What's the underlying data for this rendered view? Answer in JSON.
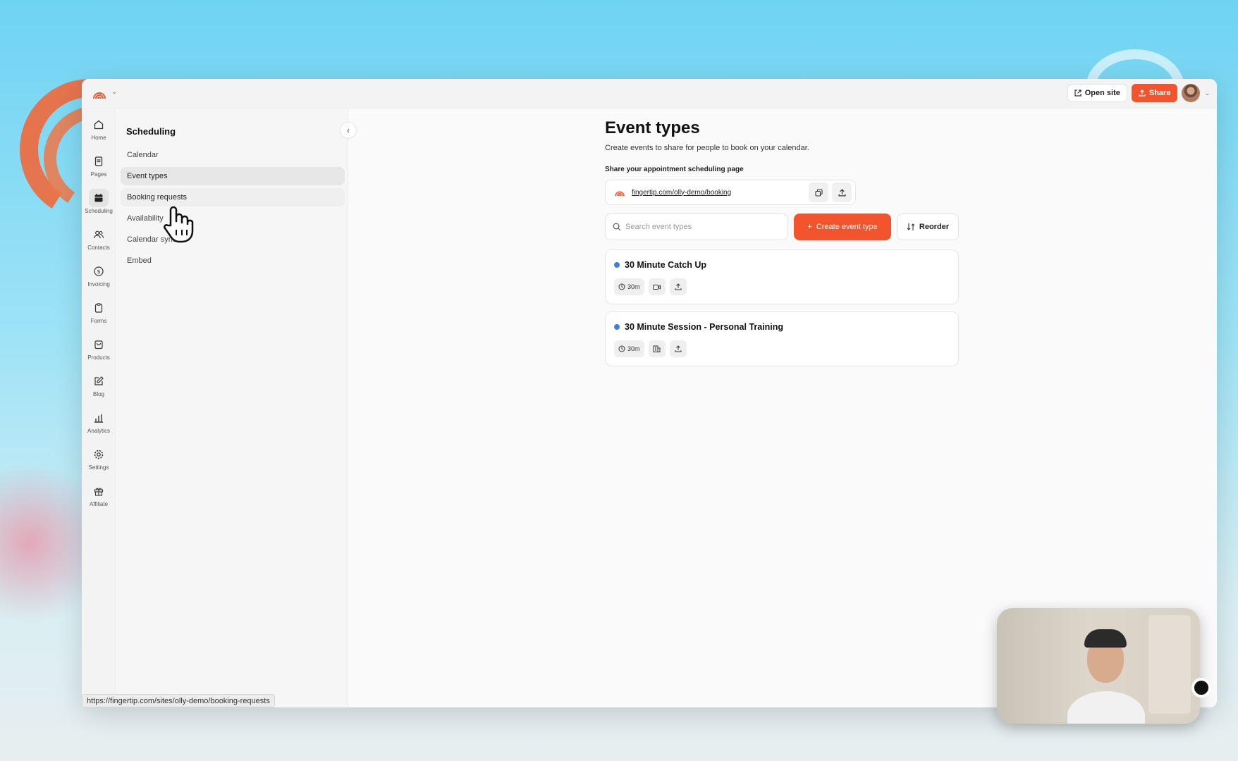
{
  "topbar": {
    "open_site_label": "Open site",
    "share_label": "Share"
  },
  "rail": {
    "items": [
      {
        "label": "Home",
        "icon": "home-icon"
      },
      {
        "label": "Pages",
        "icon": "pages-icon"
      },
      {
        "label": "Scheduling",
        "icon": "calendar-icon",
        "active": true
      },
      {
        "label": "Contacts",
        "icon": "contacts-icon"
      },
      {
        "label": "Invoicing",
        "icon": "dollar-icon"
      },
      {
        "label": "Forms",
        "icon": "clipboard-icon"
      },
      {
        "label": "Products",
        "icon": "bag-icon"
      },
      {
        "label": "Blog",
        "icon": "edit-icon"
      },
      {
        "label": "Analytics",
        "icon": "bar-chart-icon"
      },
      {
        "label": "Settings",
        "icon": "gear-icon"
      },
      {
        "label": "Affiliate",
        "icon": "gift-icon"
      }
    ]
  },
  "subnav": {
    "title": "Scheduling",
    "items": [
      {
        "label": "Calendar"
      },
      {
        "label": "Event types",
        "active": true
      },
      {
        "label": "Booking requests",
        "hover": true
      },
      {
        "label": "Availability"
      },
      {
        "label": "Calendar sync"
      },
      {
        "label": "Embed"
      }
    ]
  },
  "main": {
    "title": "Event types",
    "subtitle": "Create events to share for people to book on your calendar.",
    "share_label": "Share your appointment scheduling page",
    "booking_link": "fingertip.com/olly-demo/booking",
    "search_placeholder": "Search event types",
    "create_label": "Create event type",
    "reorder_label": "Reorder",
    "events": [
      {
        "title": "30 Minute Catch Up",
        "duration": "30m",
        "location_icon": "video-icon"
      },
      {
        "title": "30 Minute Session - Personal Training",
        "duration": "30m",
        "location_icon": "building-icon"
      }
    ]
  },
  "status_url": "https://fingertip.com/sites/olly-demo/booking-requests",
  "colors": {
    "accent": "#f2542d",
    "event_dot": "#3b7fe0"
  }
}
